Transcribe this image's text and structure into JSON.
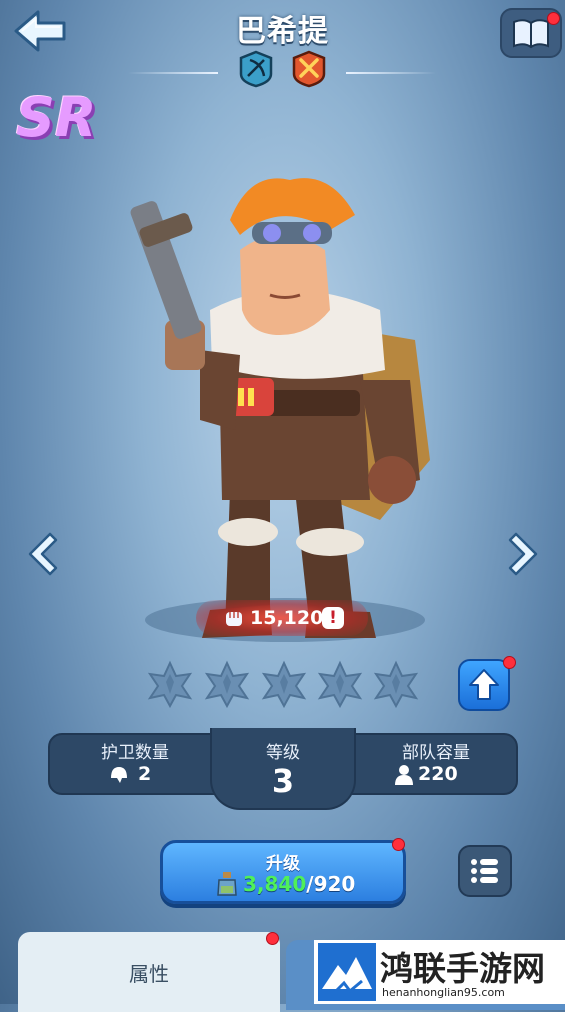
{
  "hero": {
    "name": "巴希提",
    "rarity": "SR",
    "power": "15,120",
    "power_alert": "!"
  },
  "class_badges": [
    "archer-class-icon",
    "attack-class-icon"
  ],
  "stars": {
    "filled": 0,
    "total": 5
  },
  "stats": {
    "guards_label": "护卫数量",
    "guards_value": "2",
    "level_label": "等级",
    "level_value": "3",
    "capacity_label": "部队容量",
    "capacity_value": "220"
  },
  "level_up": {
    "label": "升级",
    "current": "3,840",
    "separator_total": "/920"
  },
  "tabs": {
    "attributes_label": "属性"
  },
  "watermark": {
    "name": "鸿联手游网",
    "url": "henanhonglian95.com"
  },
  "colors": {
    "background": "#8fb3d2",
    "panel": "#2d4866",
    "button_blue": "#2c7fe0",
    "alert_red": "#ff2f3c",
    "cost_green": "#4ff05a",
    "rarity_purple": "#e69bff"
  }
}
